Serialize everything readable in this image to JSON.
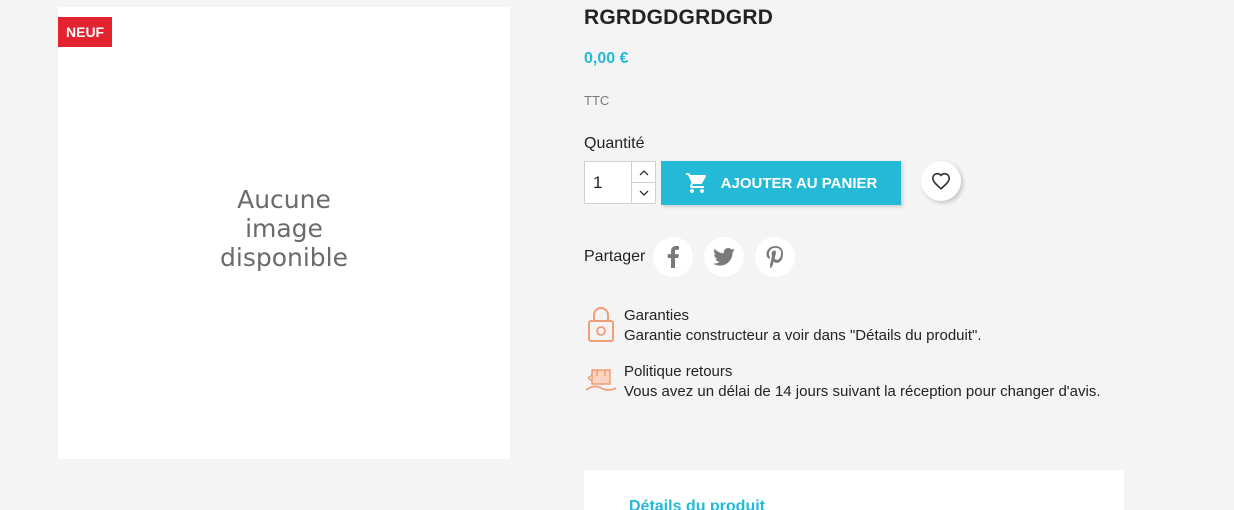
{
  "product": {
    "badge": "NEUF",
    "no_image_text": "Aucune image disponible",
    "title": "RGRDGDGRDGRD",
    "price": "0,00 €",
    "tax_label": "TTC"
  },
  "purchase": {
    "quantity_label": "Quantité",
    "quantity_value": "1",
    "add_to_cart_label": "Ajouter au panier"
  },
  "share": {
    "label": "Partager",
    "networks": [
      "facebook",
      "twitter",
      "pinterest"
    ]
  },
  "reassurance": [
    {
      "title": "Garanties",
      "text": "Garantie constructeur a voir dans \"Détails du produit\".",
      "icon": "padlock-icon"
    },
    {
      "title": "Politique retours",
      "text": "Vous avez un délai de 14 jours suivant la réception pour changer d'avis.",
      "icon": "return-box-icon"
    }
  ],
  "tabs": {
    "details_label": "Détails du produit"
  },
  "colors": {
    "accent": "#24b9d7",
    "badge": "#e32330",
    "reassurance_icon": "#f19d76",
    "background": "#f4f4f4"
  }
}
